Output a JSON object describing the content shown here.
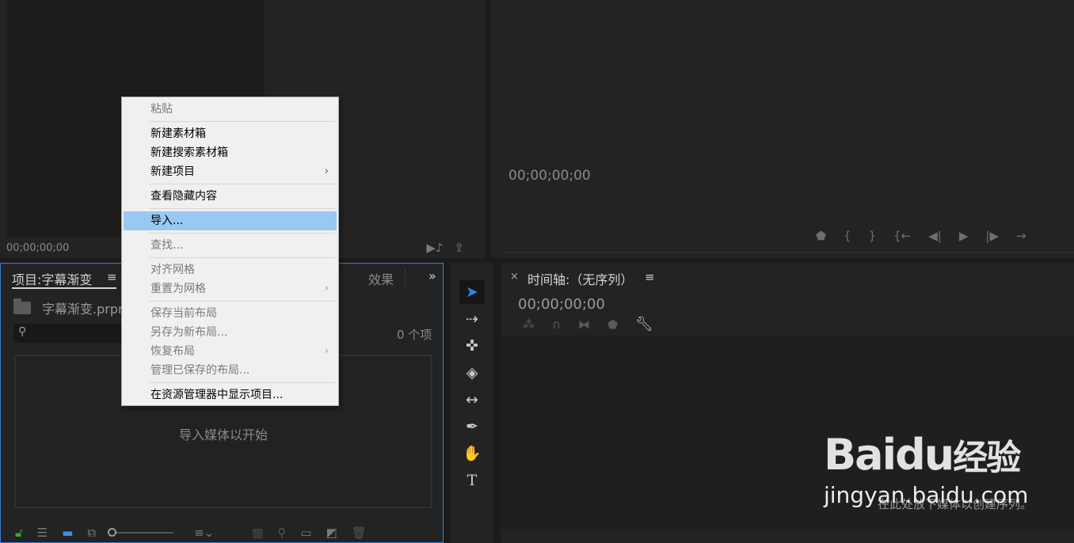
{
  "source_monitor": {
    "timecode": "00;00;00;00",
    "icons": [
      "audio-note-icon",
      "export-frame-icon"
    ]
  },
  "program_monitor": {
    "timecode": "00;00;00;00",
    "controls": [
      "marker-icon",
      "in-point-icon",
      "out-point-icon",
      "go-to-in-icon",
      "step-back-icon",
      "play-icon",
      "step-forward-icon",
      "go-to-out-icon"
    ]
  },
  "project_panel": {
    "tab_label": "项目:字幕渐变",
    "menu_icon": "≡",
    "effects_tab": "效果",
    "more_icon": "»",
    "file_name": "字幕渐变.prpro",
    "search_placeholder": "",
    "item_count": "0 个项",
    "drop_hint": "导入媒体以开始"
  },
  "tools": [
    "selection-tool",
    "track-select-tool",
    "ripple-edit-tool",
    "razor-tool",
    "slip-tool",
    "pen-tool",
    "hand-tool",
    "type-tool"
  ],
  "timeline_panel": {
    "close": "×",
    "tab_label": "时间轴:（无序列）",
    "menu_icon": "≡",
    "timecode": "00;00;00;00",
    "drop_hint": "在此处放下媒体以创建序列。"
  },
  "context_menu": {
    "items": [
      {
        "label": "粘贴",
        "enabled": false
      },
      {
        "label": "新建素材箱",
        "enabled": true
      },
      {
        "label": "新建搜索素材箱",
        "enabled": true
      },
      {
        "label": "新建项目",
        "enabled": true,
        "submenu": true
      },
      {
        "label": "查看隐藏内容",
        "enabled": true
      },
      {
        "label": "导入...",
        "enabled": true,
        "highlighted": true
      },
      {
        "label": "查找...",
        "enabled": false
      },
      {
        "label": "对齐网格",
        "enabled": false
      },
      {
        "label": "重置为网格",
        "enabled": false,
        "submenu": true
      },
      {
        "label": "保存当前布局",
        "enabled": false
      },
      {
        "label": "另存为新布局...",
        "enabled": false
      },
      {
        "label": "恢复布局",
        "enabled": false,
        "submenu": true
      },
      {
        "label": "管理已保存的布局...",
        "enabled": false
      },
      {
        "label": "在资源管理器中显示项目...",
        "enabled": true
      }
    ]
  },
  "watermark": {
    "logo": "Bai du 经验",
    "logo_bai": "Bai",
    "logo_du": "du",
    "logo_jy": "经验",
    "url": "jingyan.baidu.com"
  },
  "colors": {
    "accent": "#3b7cd2",
    "menu_highlight": "#99c8f2",
    "tool_selected": "#2f86e6"
  }
}
